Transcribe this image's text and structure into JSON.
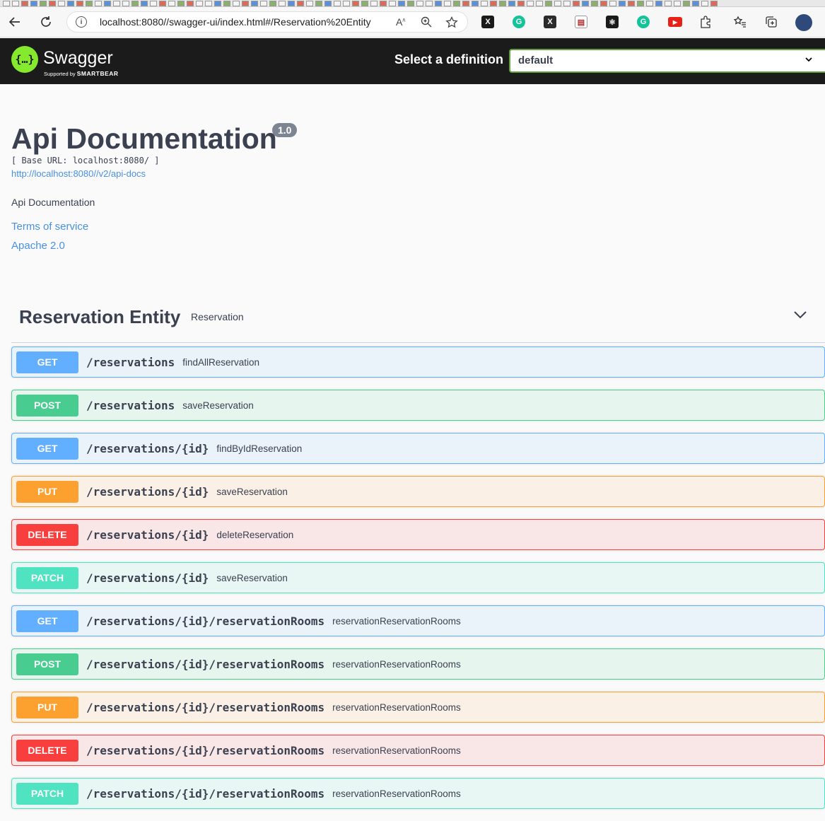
{
  "browser": {
    "url": "localhost:8080//swagger-ui/index.html#/Reservation%20Entity",
    "extensions": [
      {
        "name": "excel-extension",
        "color": "#1a1a1a",
        "glyph": "X"
      },
      {
        "name": "grammarly",
        "color": "#15c39a",
        "glyph": "G"
      },
      {
        "name": "x-extension",
        "color": "#2b2b2b",
        "glyph": "X"
      },
      {
        "name": "document-extension",
        "color": "#b03030",
        "glyph": "▤"
      },
      {
        "name": "react-devtools",
        "color": "#1a1a1a",
        "glyph": "⚛"
      },
      {
        "name": "grammarly-2",
        "color": "#15c39a",
        "glyph": "G"
      },
      {
        "name": "youtube-extension",
        "color": "#e62117",
        "glyph": "▶"
      }
    ]
  },
  "topbar": {
    "logo_title": "Swagger",
    "logo_supported": "Supported by",
    "logo_brand": "SMARTBEAR",
    "definition_label": "Select a definition",
    "definition_value": "default"
  },
  "info": {
    "title": "Api Documentation",
    "version": "1.0",
    "base_url": "[ Base URL: localhost:8080/ ]",
    "api_docs_link": "http://localhost:8080//v2/api-docs",
    "description": "Api Documentation",
    "terms": "Terms of service",
    "license": "Apache 2.0"
  },
  "tag": {
    "name": "Reservation Entity",
    "description": "Reservation"
  },
  "operations": [
    {
      "method": "GET",
      "path": "/reservations",
      "summary": "findAllReservation"
    },
    {
      "method": "POST",
      "path": "/reservations",
      "summary": "saveReservation"
    },
    {
      "method": "GET",
      "path": "/reservations/{id}",
      "summary": "findByIdReservation"
    },
    {
      "method": "PUT",
      "path": "/reservations/{id}",
      "summary": "saveReservation"
    },
    {
      "method": "DELETE",
      "path": "/reservations/{id}",
      "summary": "deleteReservation"
    },
    {
      "method": "PATCH",
      "path": "/reservations/{id}",
      "summary": "saveReservation"
    },
    {
      "method": "GET",
      "path": "/reservations/{id}/reservationRooms",
      "summary": "reservationReservationRooms"
    },
    {
      "method": "POST",
      "path": "/reservations/{id}/reservationRooms",
      "summary": "reservationReservationRooms"
    },
    {
      "method": "PUT",
      "path": "/reservations/{id}/reservationRooms",
      "summary": "reservationReservationRooms"
    },
    {
      "method": "DELETE",
      "path": "/reservations/{id}/reservationRooms",
      "summary": "reservationReservationRooms"
    },
    {
      "method": "PATCH",
      "path": "/reservations/{id}/reservationRooms",
      "summary": "reservationReservationRooms"
    }
  ]
}
